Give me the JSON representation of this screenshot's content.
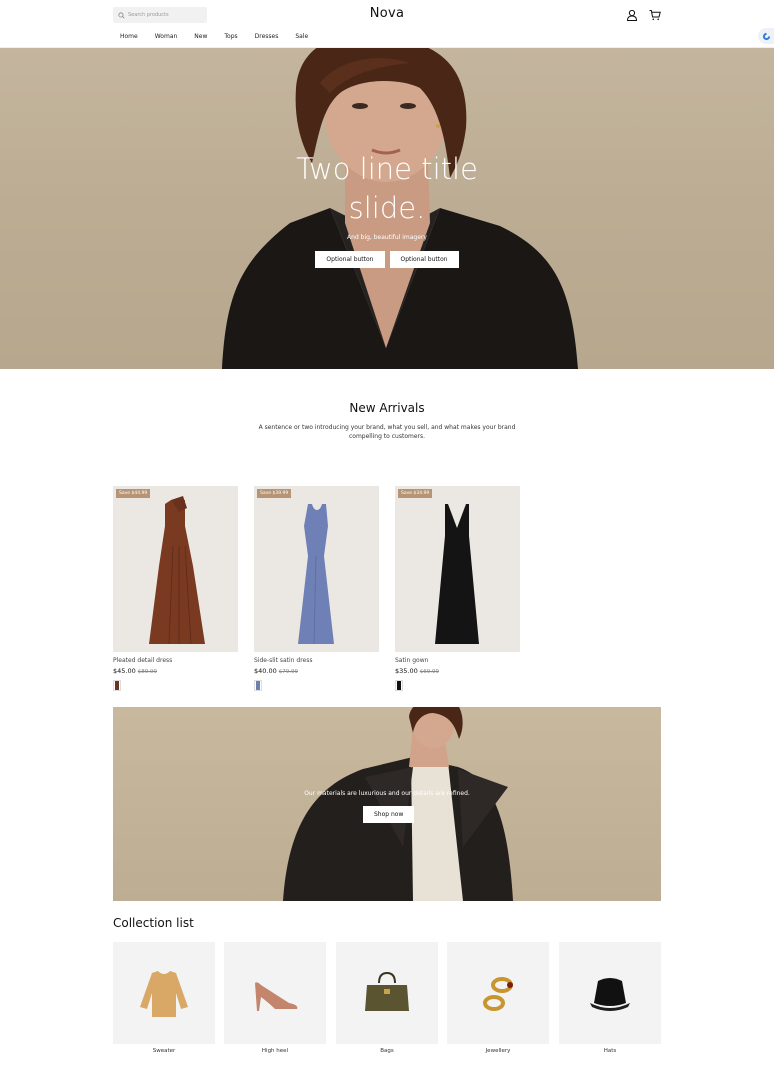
{
  "header": {
    "logo": "Nova",
    "search_placeholder": "Search products",
    "nav": [
      "Home",
      "Woman",
      "New",
      "Tops",
      "Dresses",
      "Sale"
    ]
  },
  "hero": {
    "title_line1": "Two line title",
    "title_line2": "slide.",
    "subtitle": "And big, beautiful imagery",
    "button1": "Optional button",
    "button2": "Optional button"
  },
  "new_arrivals": {
    "title": "New Arrivals",
    "description": "A sentence or two introducing your brand, what you sell, and what makes your brand compelling to customers.",
    "products": [
      {
        "badge": "Save $44.99",
        "name": "Pleated detail dress",
        "price": "$45.00",
        "old_price": "$89.99",
        "swatch_color": "#6b3420",
        "dress_color": "#7a3a22"
      },
      {
        "badge": "Save $39.99",
        "name": "Side-slit satin dress",
        "price": "$40.00",
        "old_price": "$79.99",
        "swatch_color": "#6f7fb0",
        "dress_color": "#6e80b5"
      },
      {
        "badge": "Save $34.99",
        "name": "Satin gown",
        "price": "$35.00",
        "old_price": "$69.99",
        "swatch_color": "#111111",
        "dress_color": "#141414"
      }
    ]
  },
  "promo": {
    "text": "Our materials are luxurious and our details are refined.",
    "button": "Shop now"
  },
  "collections": {
    "title": "Collection list",
    "items": [
      "Sweater",
      "High heel",
      "Bags",
      "Jewellery",
      "Hats"
    ]
  },
  "colors": {
    "badge": "#b69474",
    "hero_bg": "#bcac93",
    "tile_bg": "#f3f3f3"
  }
}
